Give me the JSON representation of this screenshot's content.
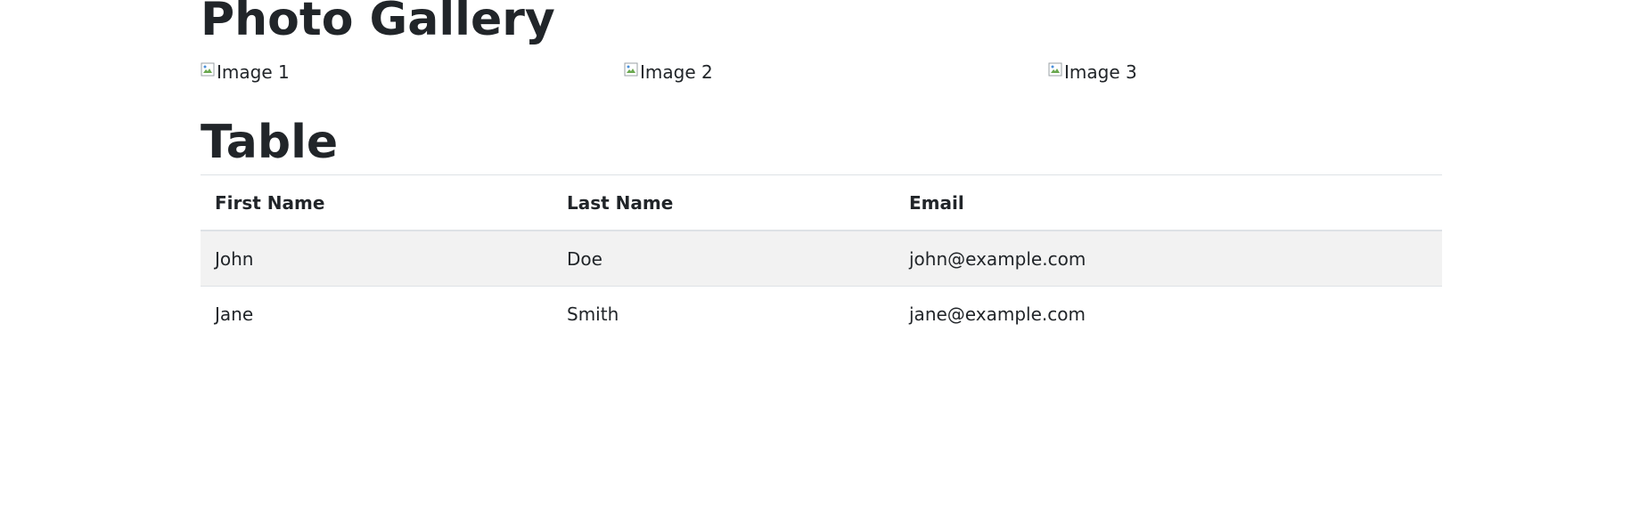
{
  "gallery": {
    "title": "Photo Gallery",
    "images": [
      {
        "alt": "Image 1"
      },
      {
        "alt": "Image 2"
      },
      {
        "alt": "Image 3"
      }
    ]
  },
  "table_section": {
    "title": "Table",
    "headers": [
      "First Name",
      "Last Name",
      "Email"
    ],
    "rows": [
      [
        "John",
        "Doe",
        "john@example.com"
      ],
      [
        "Jane",
        "Smith",
        "jane@example.com"
      ]
    ]
  },
  "colors": {
    "text": "#212529",
    "stripe": "#f2f2f2",
    "border": "#dee2e6"
  }
}
